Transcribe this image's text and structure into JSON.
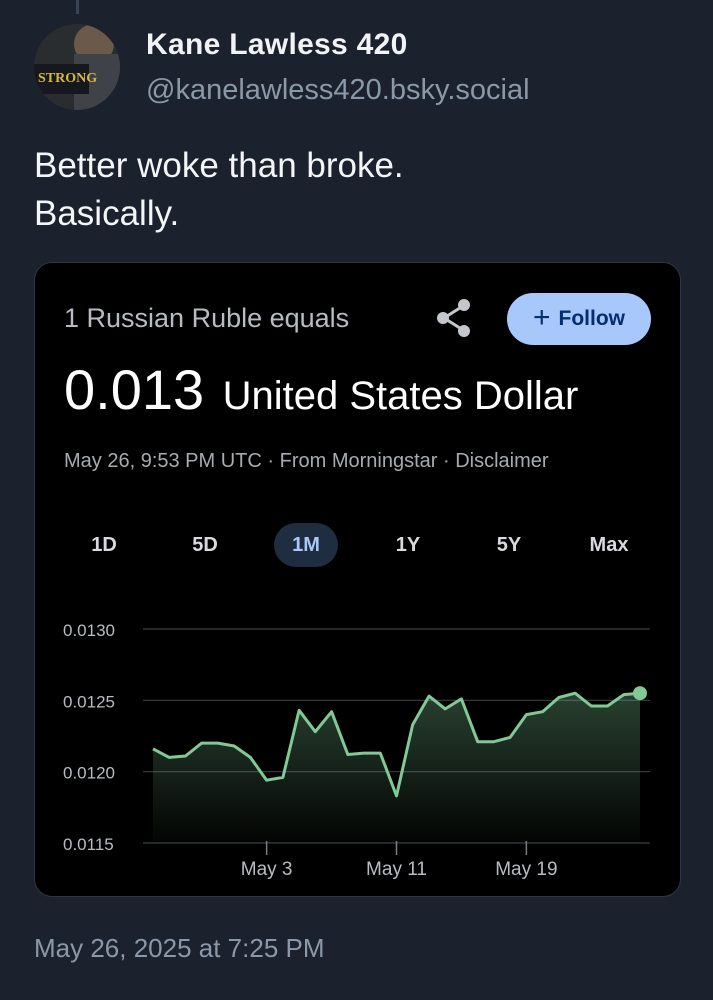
{
  "author": {
    "display_name": "Kane Lawless 420",
    "handle": "@kanelawless420.bsky.social",
    "avatar_text": "STRONG"
  },
  "post": {
    "text_line1": "Better woke than broke.",
    "text_line2": "Basically.",
    "timestamp": "May 26, 2025 at 7:25 PM"
  },
  "card": {
    "subtitle": "1 Russian Ruble equals",
    "rate_value": "0.013",
    "rate_currency": "United States Dollar",
    "meta": "May 26, 9:53 PM UTC · From Morningstar · Disclaimer",
    "follow_label": "Follow",
    "share_icon": "share-icon",
    "ranges": [
      "1D",
      "5D",
      "1M",
      "1Y",
      "5Y",
      "Max"
    ],
    "active_range": "1M",
    "accent": "#a8c7fa",
    "line_color": "#81c995"
  },
  "chart_data": {
    "type": "area",
    "y_ticks": [
      "0.0130",
      "0.0125",
      "0.0120",
      "0.0115"
    ],
    "ylim": [
      0.0115,
      0.013
    ],
    "x_ticks": [
      "May 3",
      "May 11",
      "May 19"
    ],
    "x": [
      "Apr 26",
      "Apr 27",
      "Apr 28",
      "Apr 29",
      "Apr 30",
      "May 1",
      "May 2",
      "May 3",
      "May 4",
      "May 5",
      "May 6",
      "May 7",
      "May 8",
      "May 9",
      "May 10",
      "May 11",
      "May 12",
      "May 13",
      "May 14",
      "May 15",
      "May 16",
      "May 17",
      "May 18",
      "May 19",
      "May 20",
      "May 21",
      "May 22",
      "May 23",
      "May 24",
      "May 25",
      "May 26"
    ],
    "values": [
      0.01216,
      0.0121,
      0.01211,
      0.0122,
      0.0122,
      0.01218,
      0.0121,
      0.01194,
      0.01196,
      0.01243,
      0.01228,
      0.01242,
      0.01212,
      0.01213,
      0.01213,
      0.01183,
      0.01233,
      0.01253,
      0.01244,
      0.01251,
      0.01221,
      0.01221,
      0.01224,
      0.0124,
      0.01242,
      0.01252,
      0.01255,
      0.01246,
      0.01246,
      0.01254,
      0.01255
    ],
    "grid": true
  }
}
